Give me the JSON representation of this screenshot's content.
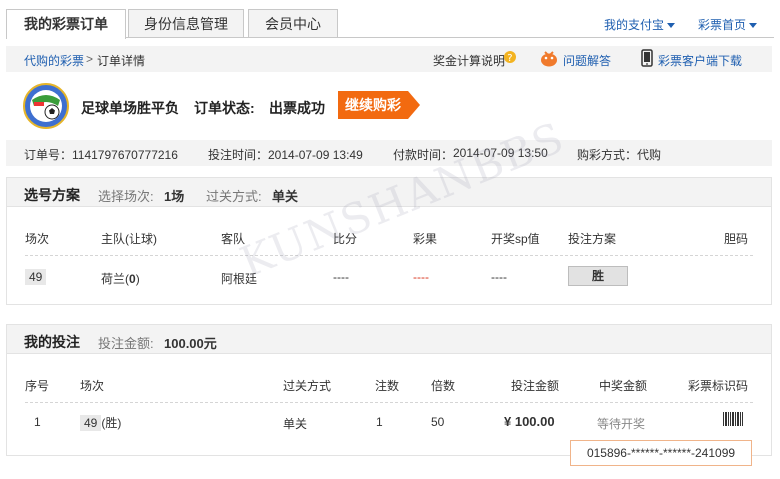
{
  "tabs": [
    {
      "label": "我的彩票订单",
      "active": true
    },
    {
      "label": "身份信息管理",
      "active": false
    },
    {
      "label": "会员中心",
      "active": false
    }
  ],
  "toplinks": {
    "alipay": "我的支付宝",
    "lottery_home": "彩票首页"
  },
  "breadcrumb": {
    "root": "代购的彩票",
    "sep": ">",
    "current": "订单详情"
  },
  "help_links": {
    "prize_calc": "奖金计算说明",
    "faq": "问题解答",
    "client_download": "彩票客户端下载"
  },
  "product": {
    "name": "足球单场胜平负",
    "status_label": "订单状态:",
    "status_value": "出票成功",
    "continue_button": "继续购彩"
  },
  "order_info": {
    "order_no": "订单号：1141797670777216",
    "bet_time": "投注时间：2014-07-09 13:49",
    "pay_time_label": "付款时间：",
    "pay_time": "2014-07-09 13:50",
    "buy_mode": "购彩方式：代购"
  },
  "selection": {
    "title": "选号方案",
    "matches_label": "选择场次:",
    "matches_value": "1场",
    "pass_label": "过关方式:",
    "pass_value": "单关",
    "headers": [
      "场次",
      "主队(让球)",
      "客队",
      "比分",
      "彩果",
      "开奖sp值",
      "投注方案",
      "胆码"
    ],
    "row": {
      "match": "49",
      "home": "荷兰(",
      "handicap": "0",
      "home_close": ")",
      "away": "阿根廷",
      "score": "----",
      "result": "----",
      "sp": "----",
      "bet": "胜"
    }
  },
  "mybet": {
    "title": "我的投注",
    "amount_label": "投注金额:",
    "amount_value": "100.00元",
    "headers": [
      "序号",
      "场次",
      "过关方式",
      "注数",
      "倍数",
      "投注金额",
      "中奖金额",
      "彩票标识码"
    ],
    "row": {
      "seq": "1",
      "match": "49",
      "match_pick": "(胜)",
      "pass": "单关",
      "count": "1",
      "multiple": "50",
      "amount": "¥ 100.00",
      "prize": "等待开奖"
    },
    "ticket_code": "015896-******-******-241099"
  },
  "watermark": "KUNSHANBBS",
  "colors": {
    "accent": "#f26a10",
    "link": "#1f5fb0",
    "result_red": "#d9341c"
  }
}
